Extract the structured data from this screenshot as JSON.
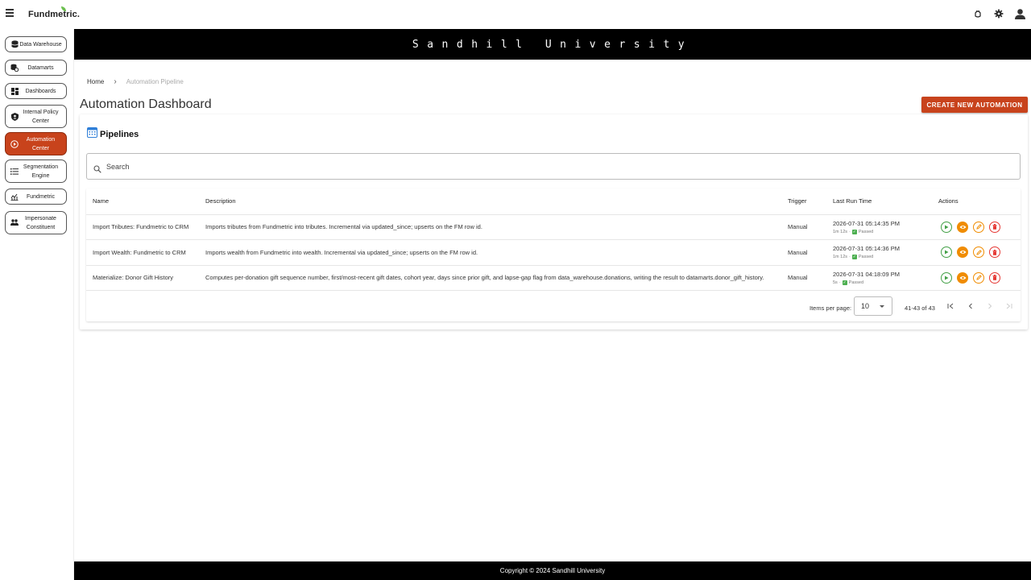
{
  "app": {
    "logo": "Fundmetric."
  },
  "header": {
    "icons": [
      "bug-report-icon",
      "settings-gear-icon",
      "account-icon"
    ]
  },
  "sidebar": {
    "items": [
      {
        "label": "Data Warehouse",
        "icon": "database-icon"
      },
      {
        "label": "Datamarts",
        "icon": "datamart-icon"
      },
      {
        "label": "Dashboards",
        "icon": "dashboard-icon"
      },
      {
        "label": "Internal Policy Center",
        "icon": "policy-shield-icon"
      },
      {
        "label": "Automation Center",
        "icon": "play-circle-icon",
        "active": true
      },
      {
        "label": "Segmentation Engine",
        "icon": "list-icon"
      },
      {
        "label": "Fundmetric",
        "icon": "analytics-icon"
      },
      {
        "label": "Impersonate Constituent",
        "icon": "people-icon"
      }
    ]
  },
  "banner": {
    "title": "Sandhill University"
  },
  "breadcrumb": {
    "home": "Home",
    "current": "Automation Pipeline"
  },
  "page": {
    "title": "Automation Dashboard",
    "create_button": "CREATE NEW AUTOMATION"
  },
  "pipelines": {
    "title": "Pipelines",
    "search_placeholder": "Search",
    "columns": {
      "name": "Name",
      "description": "Description",
      "trigger": "Trigger",
      "last_run": "Last Run Time",
      "actions": "Actions"
    },
    "rows": [
      {
        "name": "Import Tributes: Fundmetric to CRM",
        "description": "Imports tributes from Fundmetric into tributes. Incremental via updated_since; upserts on the FM row id.",
        "trigger": "Manual",
        "last_run": "2026-07-31 05:14:35 PM",
        "duration": "1m 12s",
        "status": "Passed"
      },
      {
        "name": "Import Wealth: Fundmetric to CRM",
        "description": "Imports wealth from Fundmetric into wealth. Incremental via updated_since; upserts on the FM row id.",
        "trigger": "Manual",
        "last_run": "2026-07-31 05:14:36 PM",
        "duration": "1m 12s",
        "status": "Passed"
      },
      {
        "name": "Materialize: Donor Gift History",
        "description": "Computes per-donation gift sequence number, first/most-recent gift dates, cohort year, days since prior gift, and lapse-gap flag from data_warehouse.donations, writing the result to datamarts.donor_gift_history.",
        "trigger": "Manual",
        "last_run": "2026-07-31 04:18:09 PM",
        "duration": "5s",
        "status": "Passed"
      }
    ],
    "pager": {
      "items_per_page_label": "Items per page:",
      "items_per_page": "10",
      "range": "41-43 of 43"
    }
  },
  "colors": {
    "accent": "#c8431c",
    "run": "#43a047",
    "view": "#f08c00",
    "edit": "#f08c00",
    "delete": "#e53935"
  },
  "footer": {
    "copyright": "Copyright © 2024 Sandhill University"
  }
}
